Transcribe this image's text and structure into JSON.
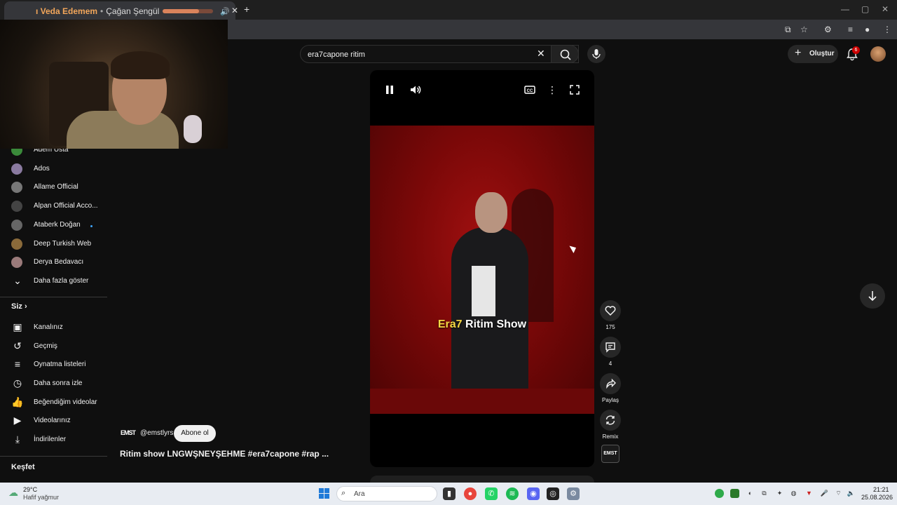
{
  "browser": {
    "tab_title_part1": "ı Veda Edemem",
    "tab_title_sep": "•",
    "tab_title_part2": "Çağan Şengül",
    "tab_media_progress": 0.72,
    "tab_close": "✕",
    "new_tab": "+",
    "window_minimize": "—",
    "window_restore": "▢",
    "window_close": "✕"
  },
  "search": {
    "value": "era7capone ritim",
    "clear_icon": "✕"
  },
  "header": {
    "create_label": "Oluştur",
    "notifications_count": "6"
  },
  "sidebar": {
    "subscriptions": [
      {
        "label": "Adem Usta",
        "color": "#3a8a3a"
      },
      {
        "label": "Ados",
        "color": "#8a7aa0"
      },
      {
        "label": "Allame Official",
        "color": "#777777"
      },
      {
        "label": "Alpan Official Acco...",
        "color": "#444444"
      },
      {
        "label": "Ataberk Doğan",
        "color": "#666666",
        "new": true
      },
      {
        "label": "Deep Turkish Web",
        "color": "#8a6a3a"
      },
      {
        "label": "Derya Bedavacı",
        "color": "#9a7a7a"
      }
    ],
    "show_more": "Daha fazla göster",
    "you_heading": "Siz",
    "you_items": [
      {
        "label": "Kanalınız",
        "icon": "person-box-icon"
      },
      {
        "label": "Geçmiş",
        "icon": "history-icon"
      },
      {
        "label": "Oynatma listeleri",
        "icon": "playlist-icon"
      },
      {
        "label": "Daha sonra izle",
        "icon": "clock-icon"
      },
      {
        "label": "Beğendiğim videolar",
        "icon": "thumbs-up-icon"
      },
      {
        "label": "Videolarınız",
        "icon": "video-icon"
      },
      {
        "label": "İndirilenler",
        "icon": "download-icon"
      }
    ],
    "explore_heading": "Keşfet"
  },
  "video": {
    "caption_highlight": "Era7",
    "caption_rest": "Ritim Show",
    "channel_logo": "EMST",
    "channel_handle": "@emstlyrs",
    "subscribe_label": "Abone ol",
    "title": "Ritim show LNGWŞNEYŞEHME #era7capone #rap ..."
  },
  "actions": {
    "likes": "175",
    "comments": "4",
    "share_label": "Paylaş",
    "remix_label": "Remix",
    "sound_label": "EMST"
  },
  "taskbar": {
    "temperature": "29°C",
    "weather": "Hafif yağmur",
    "search_placeholder": "Ara",
    "time": "21:21",
    "date": "25.08.2026"
  },
  "colors": {
    "background": "#0f0f0f",
    "caption_highlight": "#f5d742",
    "notification_badge": "#cc0000",
    "video_backdrop": "#7a0808"
  }
}
